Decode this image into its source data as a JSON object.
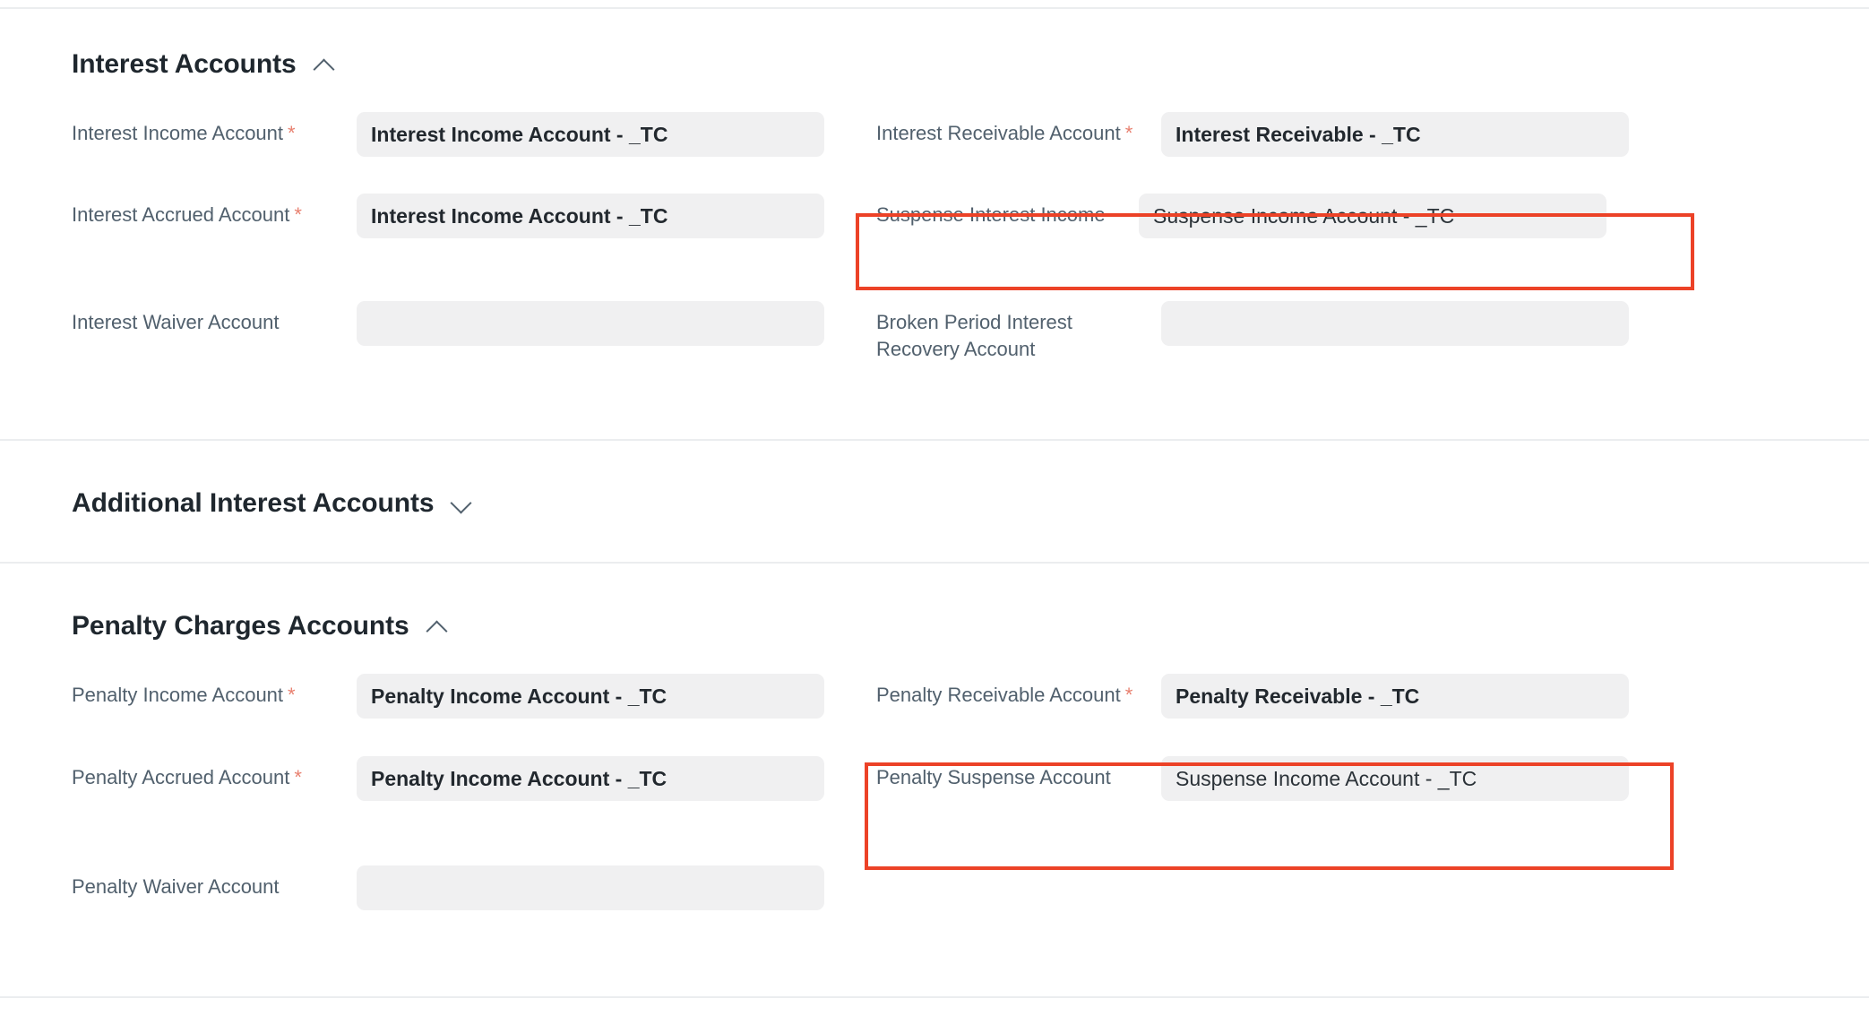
{
  "sections": [
    {
      "id": "interest-accounts",
      "title": "Interest Accounts",
      "toggle_icon": "chevron-up-icon",
      "expanded": true,
      "fields": [
        {
          "label": "Interest Income Account",
          "required": true,
          "value": "Interest Income Account - _TC",
          "column": "left",
          "bold": true,
          "highlighted": false
        },
        {
          "label": "Interest Receivable Account",
          "required": true,
          "value": "Interest Receivable - _TC",
          "column": "right",
          "bold": true,
          "highlighted": false
        },
        {
          "label": "Interest Accrued Account",
          "required": true,
          "value": "Interest Income Account - _TC",
          "column": "left",
          "bold": true,
          "highlighted": false
        },
        {
          "label": "Suspense Interest Income",
          "required": false,
          "value": "Suspense Income Account - _TC",
          "column": "right",
          "bold": false,
          "highlighted": true
        },
        {
          "label": "Interest Waiver Account",
          "required": false,
          "value": "",
          "column": "left",
          "bold": true,
          "highlighted": false
        },
        {
          "label": "Broken Period Interest Recovery Account",
          "required": false,
          "value": "",
          "column": "right",
          "bold": true,
          "highlighted": false
        }
      ]
    },
    {
      "id": "additional-interest-accounts",
      "title": "Additional Interest Accounts",
      "toggle_icon": "chevron-down-icon",
      "expanded": false,
      "fields": []
    },
    {
      "id": "penalty-charges-accounts",
      "title": "Penalty Charges Accounts",
      "toggle_icon": "chevron-up-icon",
      "expanded": true,
      "fields": [
        {
          "label": "Penalty Income Account",
          "required": true,
          "value": "Penalty Income Account - _TC",
          "column": "left",
          "bold": true,
          "highlighted": false
        },
        {
          "label": "Penalty Receivable Account",
          "required": true,
          "value": "Penalty Receivable - _TC",
          "column": "right",
          "bold": true,
          "highlighted": false
        },
        {
          "label": "Penalty Accrued Account",
          "required": true,
          "value": "Penalty Income Account - _TC",
          "column": "left",
          "bold": true,
          "highlighted": false
        },
        {
          "label": "Penalty Suspense Account",
          "required": false,
          "value": "Suspense Income Account - _TC",
          "column": "right",
          "bold": false,
          "highlighted": true
        },
        {
          "label": "Penalty Waiver Account",
          "required": false,
          "value": "",
          "column": "left",
          "bold": true,
          "highlighted": false
        }
      ]
    }
  ],
  "required_marker": "*",
  "colors": {
    "highlight_border": "#ec4227",
    "field_background": "#f0f0f1",
    "label_text": "#51606d",
    "value_text": "#22282e",
    "required_asterisk": "#e8806f",
    "divider": "#ebedef"
  }
}
